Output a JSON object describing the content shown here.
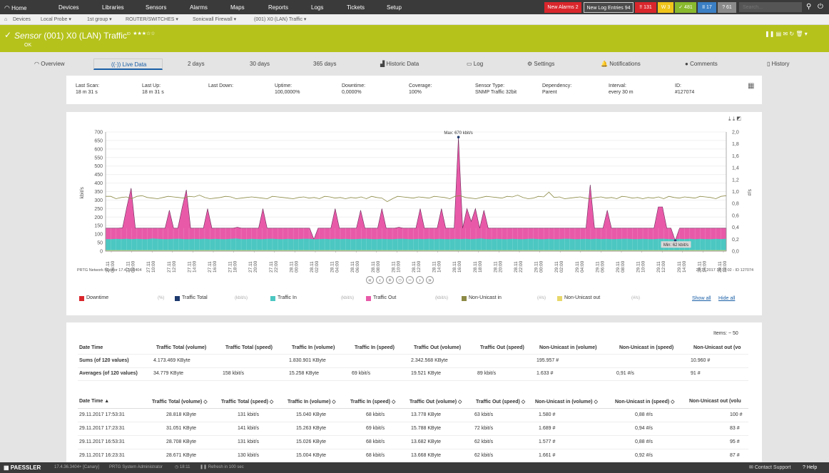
{
  "nav": {
    "home": "Home",
    "devices": "Devices",
    "libraries": "Libraries",
    "sensors": "Sensors",
    "alarms": "Alarms",
    "maps": "Maps",
    "reports": "Reports",
    "logs": "Logs",
    "tickets": "Tickets",
    "setup": "Setup",
    "new_alarms_label": "New Alarms",
    "new_alarms_count": "2",
    "new_log_label": "New Log Entries",
    "new_log_count": "94",
    "status_down": "!! 131",
    "status_warning": "W 3",
    "status_up": "✓ 481",
    "status_paused": "II 17",
    "status_unknown": "? 61",
    "search_placeholder": "Search...",
    "colors": {
      "bar": "#3a3a3a",
      "new_alarms": "#d9262c",
      "down": "#d9262c",
      "warning": "#f0c419",
      "up": "#89b92d",
      "paused": "#3b7fc4",
      "unknown": "#8a8a8a"
    }
  },
  "breadcrumb": [
    "Devices",
    "Local Probe",
    "1st group",
    "ROUTER/SWITCHES",
    "Sonicwall Firewall",
    "(001) X0 (LAN) Traffic"
  ],
  "header": {
    "prefix": "Sensor",
    "name": "(001) X0 (LAN) Traffic",
    "sup": "ID",
    "stars": "★★★☆☆",
    "status": "OK",
    "color": "#b5c21c"
  },
  "tabs": [
    "Overview",
    "Live Data",
    "2 days",
    "30 days",
    "365 days",
    "Historic Data",
    "Log",
    "Settings",
    "Notifications",
    "Comments",
    "History"
  ],
  "info": [
    {
      "label": "Last Scan:",
      "value": "18 m 31 s"
    },
    {
      "label": "Last Up:",
      "value": "18 m 31 s"
    },
    {
      "label": "Last Down:",
      "value": ""
    },
    {
      "label": "Uptime:",
      "value": "100,0000%"
    },
    {
      "label": "Downtime:",
      "value": "0,0000%"
    },
    {
      "label": "Coverage:",
      "value": "100%"
    },
    {
      "label": "Sensor Type:",
      "value": "SNMP Traffic 32bit"
    },
    {
      "label": "Dependency:",
      "value": "Parent"
    },
    {
      "label": "Interval:",
      "value": "every 30 m"
    },
    {
      "label": "ID:",
      "value": "#127074"
    }
  ],
  "chart_data": {
    "type": "area",
    "ylabel": "kbit/s",
    "y2label": "#/s",
    "ylim": [
      0,
      700
    ],
    "y2lim": [
      0,
      2
    ],
    "yticks": [
      "0",
      "50",
      "100",
      "150",
      "200",
      "250",
      "300",
      "350",
      "400",
      "450",
      "500",
      "550",
      "600",
      "650",
      "700"
    ],
    "y2ticks": [
      "0,0",
      "0,2",
      "0,4",
      "0,6",
      "0,8",
      "1,0",
      "1,2",
      "1,4",
      "1,6",
      "1,8",
      "2,0"
    ],
    "xticks": [
      "27.11 06:00",
      "27.11 08:00",
      "27.11 10:00",
      "27.11 12:00",
      "27.11 14:00",
      "27.11 16:00",
      "27.11 18:00",
      "27.11 20:00",
      "27.11 22:00",
      "28.11 00:00",
      "28.11 02:00",
      "28.11 04:00",
      "28.11 06:00",
      "28.11 08:00",
      "28.11 10:00",
      "28.11 12:00",
      "28.11 14:00",
      "28.11 16:00",
      "28.11 18:00",
      "28.11 20:00",
      "28.11 22:00",
      "29.11 00:00",
      "29.11 02:00",
      "29.11 04:00",
      "29.11 06:00",
      "29.11 08:00",
      "29.11 10:00",
      "29.11 12:00",
      "29.11 14:00",
      "29.11 16:00",
      "29.11 18:00"
    ],
    "grid": true,
    "max_label": "Max: 670 kbit/s",
    "min_label": "Min: 62 kbit/s",
    "footer_left": "PRTG Network Monitor 17.4.36.3404",
    "footer_right": "29.11.2017 18:12:02 - ID 127074",
    "series": [
      {
        "name": "Traffic In",
        "color": "#4cc7c2",
        "values": [
          70,
          70,
          72,
          71,
          73,
          70,
          72,
          71,
          70,
          74,
          72,
          71,
          70,
          72,
          73,
          71,
          70,
          72,
          71,
          73,
          70,
          72,
          71,
          70,
          72,
          74,
          71,
          70,
          72,
          71,
          70,
          72,
          73,
          71,
          70,
          72,
          70,
          71,
          73,
          72,
          70,
          71,
          72,
          70,
          73,
          71,
          72,
          70,
          71,
          72,
          73,
          71,
          70,
          72,
          71,
          70,
          72,
          73,
          71,
          70,
          72,
          71,
          73,
          70,
          72,
          71,
          70,
          72,
          71,
          73,
          70,
          72,
          74,
          71,
          70,
          72,
          71,
          70,
          72,
          71,
          70,
          72,
          73,
          71,
          70,
          72,
          70,
          71,
          73,
          72,
          70,
          71,
          72,
          70,
          73,
          71,
          72,
          70,
          71,
          72,
          73,
          71,
          70,
          72,
          71,
          70,
          72,
          73,
          71,
          70,
          72,
          71,
          73,
          70,
          72,
          71,
          70,
          72,
          71,
          73
        ]
      },
      {
        "name": "Traffic Total",
        "color": "#e85aa8",
        "values": [
          135,
          135,
          135,
          135,
          137,
          260,
          370,
          135,
          135,
          135,
          135,
          135,
          135,
          135,
          135,
          240,
          135,
          135,
          255,
          360,
          135,
          135,
          135,
          135,
          250,
          135,
          135,
          135,
          135,
          135,
          135,
          140,
          135,
          135,
          135,
          135,
          135,
          250,
          135,
          135,
          135,
          135,
          135,
          135,
          135,
          135,
          135,
          135,
          135,
          70,
          135,
          135,
          135,
          135,
          250,
          135,
          135,
          135,
          135,
          135,
          240,
          135,
          135,
          135,
          135,
          250,
          135,
          135,
          135,
          140,
          135,
          135,
          135,
          135,
          250,
          135,
          135,
          135,
          135,
          250,
          135,
          135,
          135,
          670,
          135,
          250,
          175,
          250,
          135,
          240,
          135,
          135,
          135,
          135,
          135,
          135,
          135,
          135,
          135,
          135,
          135,
          135,
          135,
          135,
          135,
          135,
          135,
          135,
          135,
          135,
          135,
          135,
          135,
          135,
          390,
          135,
          135,
          135,
          240,
          135,
          135,
          135,
          135,
          135,
          135,
          135,
          135,
          135,
          135,
          135,
          260,
          260,
          135,
          135,
          62,
          135,
          135,
          135,
          135,
          135,
          135,
          135,
          135,
          135,
          135,
          135,
          135
        ]
      },
      {
        "name": "Non-Unicast in",
        "color": "#8c8a45",
        "values": [
          0.92,
          0.92,
          0.88,
          0.9,
          0.91,
          0.88,
          0.92,
          0.93,
          0.9,
          0.89,
          0.88,
          0.9,
          0.92,
          0.91,
          0.9,
          0.89,
          0.92,
          0.91,
          0.94,
          0.9,
          0.88,
          0.89,
          0.9,
          0.92,
          0.91,
          0.88,
          0.89,
          0.9,
          0.91,
          0.9,
          0.89,
          0.88,
          0.92,
          0.91,
          0.9,
          0.89,
          0.88,
          0.9,
          0.91,
          0.89,
          0.9,
          0.88,
          0.92,
          0.91,
          0.89,
          0.9,
          0.88,
          0.9,
          0.89,
          0.91,
          0.88,
          0.92,
          0.9,
          0.89,
          0.83,
          0.88,
          0.92,
          0.91,
          0.9,
          0.89,
          0.91,
          0.9,
          0.89,
          0.92,
          0.91,
          0.9,
          0.88,
          0.92,
          0.93,
          0.9,
          0.89,
          0.88,
          0.9,
          0.92,
          0.91,
          0.9,
          0.89,
          0.92,
          0.91,
          0.94,
          0.9,
          0.88,
          0.89,
          0.92,
          0.91,
          0.99,
          0.9,
          0.91,
          0.88,
          0.89,
          0.9,
          0.91,
          0.89,
          0.88,
          0.9,
          0.91,
          0.89,
          0.9,
          0.88,
          0.92,
          0.91,
          0.89,
          0.9,
          0.88,
          0.9,
          0.89,
          0.91,
          0.88,
          0.92,
          0.9,
          0.89,
          0.91,
          0.9,
          0.89,
          0.92,
          0.91,
          0.9,
          0.88,
          0.92,
          0.93
        ]
      },
      {
        "name": "Non-Unicast out",
        "color": "#e8d86a",
        "values": [
          0,
          0,
          0,
          0,
          0,
          0,
          0,
          0,
          0,
          0
        ]
      }
    ]
  },
  "chart_nav": [
    "«",
    "‹",
    "+",
    "○",
    "−",
    "›",
    "»"
  ],
  "legend": [
    {
      "name": "Downtime",
      "unit": "(%)",
      "color": "#d9262c"
    },
    {
      "name": "Traffic Total",
      "unit": "(kbit/s)",
      "color": "#1e3a6e"
    },
    {
      "name": "Traffic In",
      "unit": "(kbit/s)",
      "color": "#4cc7c2"
    },
    {
      "name": "Traffic Out",
      "unit": "(kbit/s)",
      "color": "#e85aa8"
    },
    {
      "name": "Non-Unicast in",
      "unit": "(#/s)",
      "color": "#8c8a45"
    },
    {
      "name": "Non-Unicast out",
      "unit": "(#/s)",
      "color": "#e8d86a"
    }
  ],
  "legend_links": {
    "show_all": "Show all",
    "hide_all": "Hide all"
  },
  "table": {
    "items_label": "Items: ~ 50",
    "summary_headers": [
      "Date Time",
      "Traffic Total (volume)",
      "Traffic Total (speed)",
      "Traffic In (volume)",
      "Traffic In (speed)",
      "Traffic Out (volume)",
      "Traffic Out (speed)",
      "Non-Unicast in (volume)",
      "Non-Unicast in (speed)",
      "Non-Unicast out (vo"
    ],
    "summary_rows": [
      [
        "Sums (of 120 values)",
        "4.173.469 KByte",
        "",
        "1.830.901 KByte",
        "",
        "2.342.568 KByte",
        "",
        "195.957 #",
        "",
        "10.960 #"
      ],
      [
        "Averages (of 120 values)",
        "34.779 KByte",
        "158 kbit/s",
        "15.258 KByte",
        "69 kbit/s",
        "19.521 KByte",
        "89 kbit/s",
        "1.633 #",
        "0,91 #/s",
        "91 #"
      ]
    ],
    "headers": [
      "Date Time ▲",
      "Traffic Total (volume) ◇",
      "Traffic Total (speed) ◇",
      "Traffic In (volume) ◇",
      "Traffic In (speed) ◇",
      "Traffic Out (volume) ◇",
      "Traffic Out (speed) ◇",
      "Non-Unicast in (volume) ◇",
      "Non-Unicast in (speed) ◇",
      "Non-Unicast out (volu"
    ],
    "rows": [
      [
        "29.11.2017 17:53:31",
        "28.818 KByte",
        "131 kbit/s",
        "15.040 KByte",
        "68 kbit/s",
        "13.778 KByte",
        "63 kbit/s",
        "1.580 #",
        "0,88 #/s",
        "100 #"
      ],
      [
        "29.11.2017 17:23:31",
        "31.051 KByte",
        "141 kbit/s",
        "15.263 KByte",
        "69 kbit/s",
        "15.788 KByte",
        "72 kbit/s",
        "1.689 #",
        "0,94 #/s",
        "83 #"
      ],
      [
        "29.11.2017 16:53:31",
        "28.708 KByte",
        "131 kbit/s",
        "15.026 KByte",
        "68 kbit/s",
        "13.682 KByte",
        "62 kbit/s",
        "1.577 #",
        "0,88 #/s",
        "95 #"
      ],
      [
        "29.11.2017 16:23:31",
        "28.671 KByte",
        "130 kbit/s",
        "15.004 KByte",
        "68 kbit/s",
        "13.668 KByte",
        "62 kbit/s",
        "1.661 #",
        "0,92 #/s",
        "87 #"
      ]
    ]
  },
  "statusbar": {
    "brand": "PAESSLER",
    "version": "17.4.36.3404+ [Canary]",
    "user": "PRTG System Administrator",
    "time": "18:11",
    "refresh": "Refresh in 100 sec",
    "contact": "Contact Support",
    "help": "? Help"
  }
}
